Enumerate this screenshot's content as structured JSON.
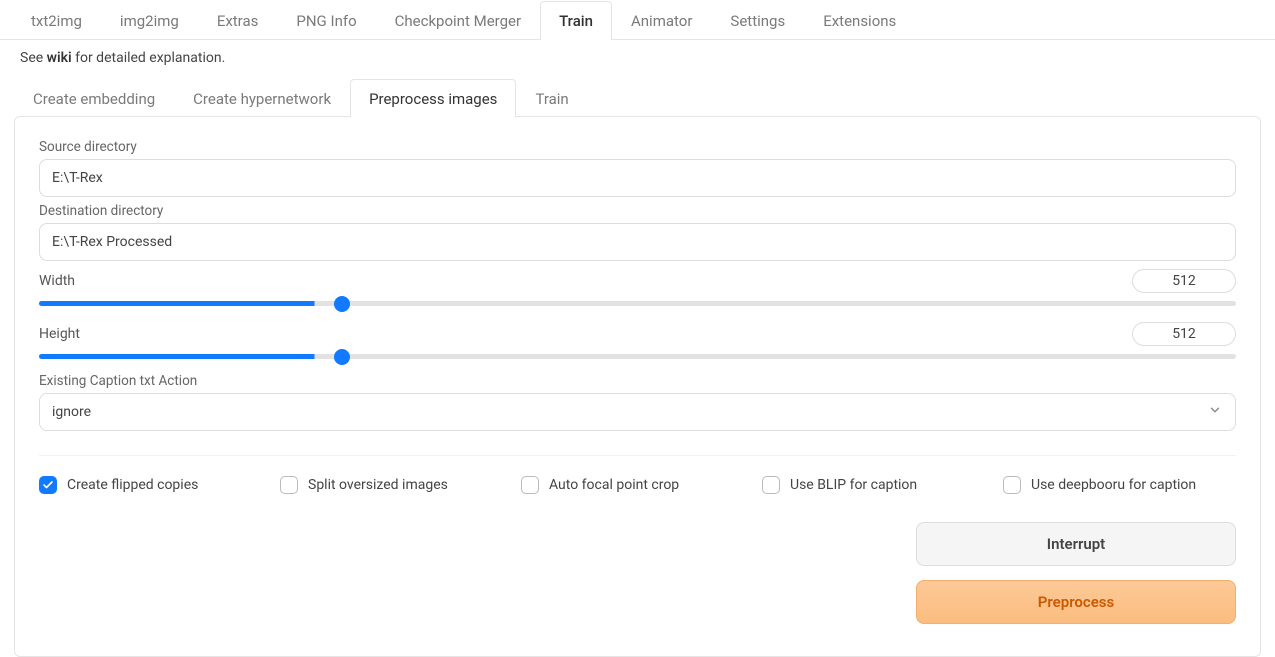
{
  "top_tabs": [
    "txt2img",
    "img2img",
    "Extras",
    "PNG Info",
    "Checkpoint Merger",
    "Train",
    "Animator",
    "Settings",
    "Extensions"
  ],
  "top_active": "Train",
  "wiki": {
    "pre": "See ",
    "link": "wiki",
    "post": " for detailed explanation."
  },
  "sub_tabs": [
    "Create embedding",
    "Create hypernetwork",
    "Preprocess images",
    "Train"
  ],
  "sub_active": "Preprocess images",
  "form": {
    "source_label": "Source directory",
    "source_value": "E:\\T-Rex",
    "dest_label": "Destination directory",
    "dest_value": "E:\\T-Rex Processed",
    "width_label": "Width",
    "width_value": "512",
    "height_label": "Height",
    "height_value": "512",
    "slider": {
      "min": 0,
      "max": 2048,
      "width_pct": "23%",
      "height_pct": "23%"
    },
    "caption_label": "Existing Caption txt Action",
    "caption_value": "ignore"
  },
  "checks": {
    "flip": {
      "label": "Create flipped copies",
      "checked": true
    },
    "split": {
      "label": "Split oversized images",
      "checked": false
    },
    "focal": {
      "label": "Auto focal point crop",
      "checked": false
    },
    "blip": {
      "label": "Use BLIP for caption",
      "checked": false
    },
    "deep": {
      "label": "Use deepbooru for caption",
      "checked": false
    }
  },
  "buttons": {
    "interrupt": "Interrupt",
    "preprocess": "Preprocess"
  }
}
